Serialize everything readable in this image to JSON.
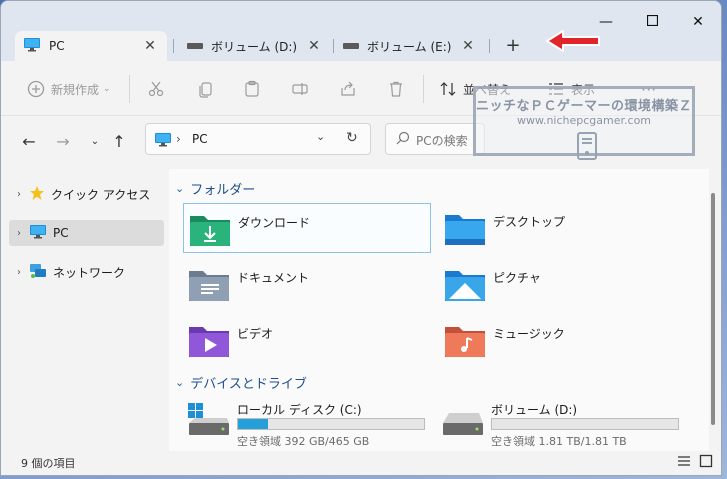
{
  "tabs": [
    {
      "label": "PC",
      "active": true
    },
    {
      "label": "ボリューム (D:)",
      "active": false
    },
    {
      "label": "ボリューム (E:)",
      "active": false
    }
  ],
  "new_tab_label": "+",
  "toolbar": {
    "new_label": "新規作成",
    "sort_label": "並べ替え",
    "view_label": "表示",
    "more_label": "···"
  },
  "address": {
    "segment": "PC",
    "chevron": "›"
  },
  "search": {
    "placeholder": "PCの検索"
  },
  "watermark": {
    "title": "ニッチなＰＣゲーマーの環境構築Ｚ",
    "url": "www.nichepcgamer.com"
  },
  "sidebar": {
    "items": [
      {
        "label": "クイック アクセス"
      },
      {
        "label": "PC",
        "selected": true
      },
      {
        "label": "ネットワーク"
      }
    ]
  },
  "groups": {
    "folders_title": "フォルダー",
    "drives_title": "デバイスとドライブ"
  },
  "folders": [
    {
      "label": "ダウンロード",
      "icon": "download-folder-icon"
    },
    {
      "label": "デスクトップ",
      "icon": "desktop-folder-icon"
    },
    {
      "label": "ドキュメント",
      "icon": "documents-folder-icon"
    },
    {
      "label": "ピクチャ",
      "icon": "pictures-folder-icon"
    },
    {
      "label": "ビデオ",
      "icon": "videos-folder-icon"
    },
    {
      "label": "ミュージック",
      "icon": "music-folder-icon"
    }
  ],
  "drives": [
    {
      "name": "ローカル ディスク (C:)",
      "free": "空き領域 392 GB/465 GB",
      "used_fraction": 0.16
    },
    {
      "name": "ボリューム (D:)",
      "free": "空き領域 1.81 TB/1.81 TB",
      "used_fraction": 0.0
    }
  ],
  "status": {
    "item_count": "9 個の項目"
  },
  "colors": {
    "accent": "#26a0da",
    "header": "#1f4f8a",
    "arrow": "#e0262a"
  }
}
